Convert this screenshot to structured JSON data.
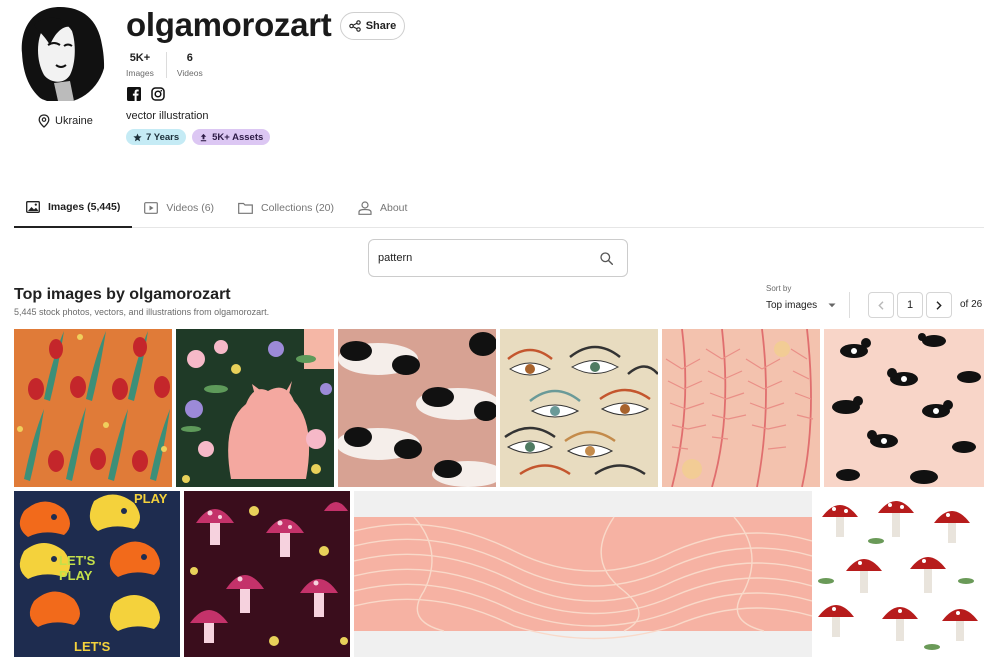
{
  "profile": {
    "username": "olgamorozart",
    "share_label": "Share",
    "location": "Ukraine",
    "stats": [
      {
        "value": "5K+",
        "label": "Images"
      },
      {
        "value": "6",
        "label": "Videos"
      }
    ],
    "socials": [
      "facebook-icon",
      "instagram-icon"
    ],
    "bio": "vector illustration",
    "badges": [
      {
        "label": "7 Years",
        "icon": "star-icon",
        "color": "#c5ebf5"
      },
      {
        "label": "5K+ Assets",
        "icon": "upload-icon",
        "color": "#dcc7f3"
      }
    ]
  },
  "tabs": [
    {
      "label": "Images (5,445)",
      "icon": "image-icon",
      "active": true
    },
    {
      "label": "Videos (6)",
      "icon": "video-icon",
      "active": false
    },
    {
      "label": "Collections (20)",
      "icon": "folder-icon",
      "active": false
    },
    {
      "label": "About",
      "icon": "person-icon",
      "active": false
    }
  ],
  "search": {
    "value": "pattern",
    "icon": "search-icon"
  },
  "results": {
    "title": "Top images by olgamorozart",
    "subtitle": "5,445 stock photos, vectors, and illustrations from olgamorozart."
  },
  "sort": {
    "label": "Sort by",
    "value": "Top images"
  },
  "pagination": {
    "current": "1",
    "total_label": "of 26"
  },
  "tiles": [
    {
      "subject": "red tulips pattern",
      "color": "#e07b38"
    },
    {
      "subject": "pink cat with flowers pattern",
      "color": "#1f3a27"
    },
    {
      "subject": "black and white cats pattern",
      "color": "#d7a293"
    },
    {
      "subject": "eyes pattern",
      "color": "#e8dcc0"
    },
    {
      "subject": "pink palm leaves pattern",
      "color": "#f3c2ae"
    },
    {
      "subject": "black cats on pink pattern",
      "color": "#f8d5c8"
    },
    {
      "subject": "game controllers let's play pattern",
      "color": "#1e2c4f"
    },
    {
      "subject": "pink mushrooms on dark pattern",
      "color": "#3a0d1c"
    },
    {
      "subject": "peach line waves banner",
      "color": "#f6b2a3"
    },
    {
      "subject": "red amanita mushrooms pattern",
      "color": "#ffffff"
    }
  ],
  "accent_color": "#212121"
}
